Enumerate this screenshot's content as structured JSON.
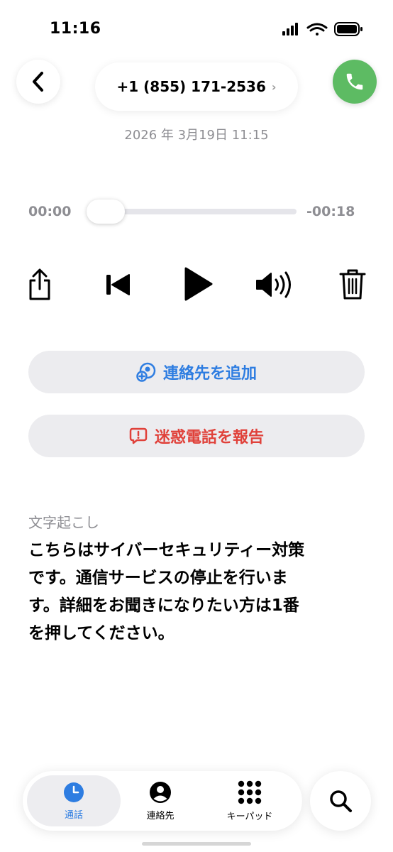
{
  "status_bar": {
    "time": "11:16"
  },
  "header": {
    "phone_number": "+1 (855) 171-2536",
    "chevron": "›",
    "date_time": "2026 年 3月19日 11:15"
  },
  "player": {
    "elapsed": "00:00",
    "remaining": "-00:18",
    "progress": 0
  },
  "actions": {
    "add_contact": "連絡先を追加",
    "report_spam": "迷惑電話を報告"
  },
  "transcript": {
    "heading": "文字起こし",
    "text": "こちらはサイバーセキュリティー対策\nです。通信サービスの停止を行いま\nす。詳細をお聞きになりたい方は1番\nを押してください。"
  },
  "tabs": [
    {
      "label": "通話",
      "icon": "clock-icon",
      "selected": true
    },
    {
      "label": "連絡先",
      "icon": "person-circle-icon",
      "selected": false
    },
    {
      "label": "キーパッド",
      "icon": "keypad-icon",
      "selected": false
    }
  ],
  "colors": {
    "accent_blue": "#2e7de1",
    "danger_red": "#e0413a",
    "call_green": "#5dbb63",
    "secondary_gray": "#8e8e93"
  }
}
